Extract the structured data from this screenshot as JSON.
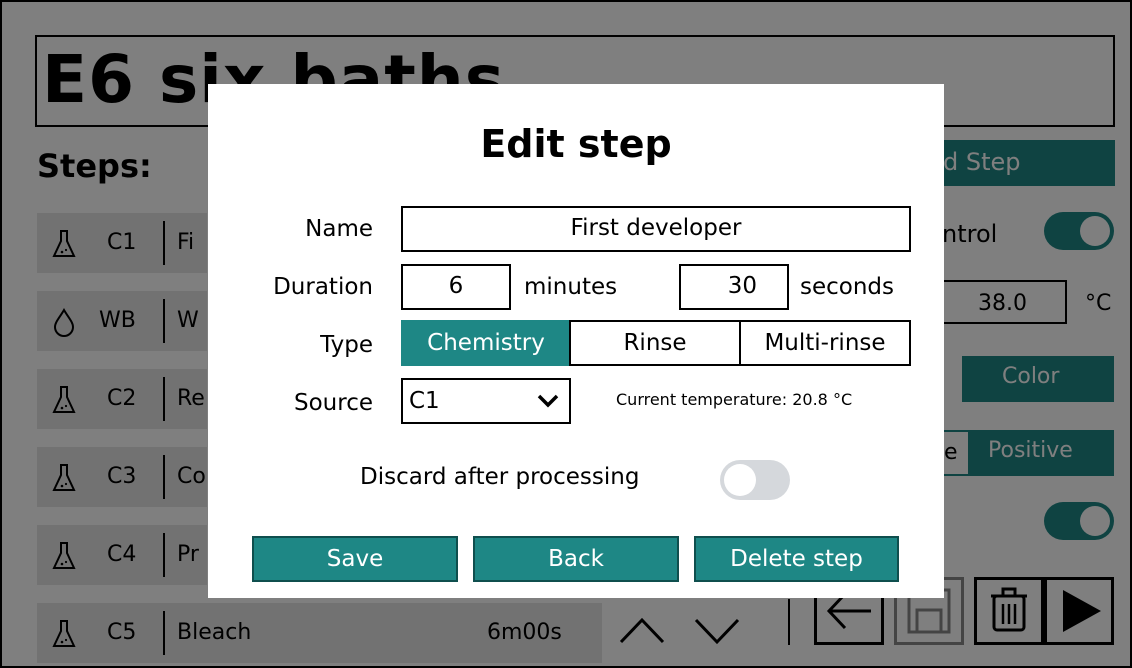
{
  "background": {
    "program_title": "E6 six baths",
    "steps_heading": "Steps:",
    "steps": [
      {
        "icon": "flask-icon",
        "code": "C1",
        "name": "Fi"
      },
      {
        "icon": "drop-icon",
        "code": "WB",
        "name": "W"
      },
      {
        "icon": "flask-icon",
        "code": "C2",
        "name": "Re"
      },
      {
        "icon": "flask-icon",
        "code": "C3",
        "name": "Co"
      },
      {
        "icon": "flask-icon",
        "code": "C4",
        "name": "Pr"
      },
      {
        "icon": "flask-icon",
        "code": "C5",
        "name": "Bleach",
        "duration": "6m00s"
      }
    ],
    "add_step_label": "d Step",
    "control_label": "ntrol",
    "temperature_value": "38.0",
    "temperature_unit": "°C",
    "film_type_color": "Color",
    "film_type_positive_partial": "e",
    "film_type_positive": "Positive",
    "accent_color": "#1e8785"
  },
  "dialog": {
    "title": "Edit step",
    "name_label": "Name",
    "name_value": "First developer",
    "duration_label": "Duration",
    "minutes_value": "6",
    "minutes_label": "minutes",
    "seconds_value": "30",
    "seconds_label": "seconds",
    "type_label": "Type",
    "type_options": [
      "Chemistry",
      "Rinse",
      "Multi-rinse"
    ],
    "type_selected": "Chemistry",
    "source_label": "Source",
    "source_value": "C1",
    "current_temperature": "Current temperature:  20.8 °C",
    "discard_label": "Discard after processing",
    "discard_enabled": false,
    "save_label": "Save",
    "back_label": "Back",
    "delete_label": "Delete step"
  }
}
